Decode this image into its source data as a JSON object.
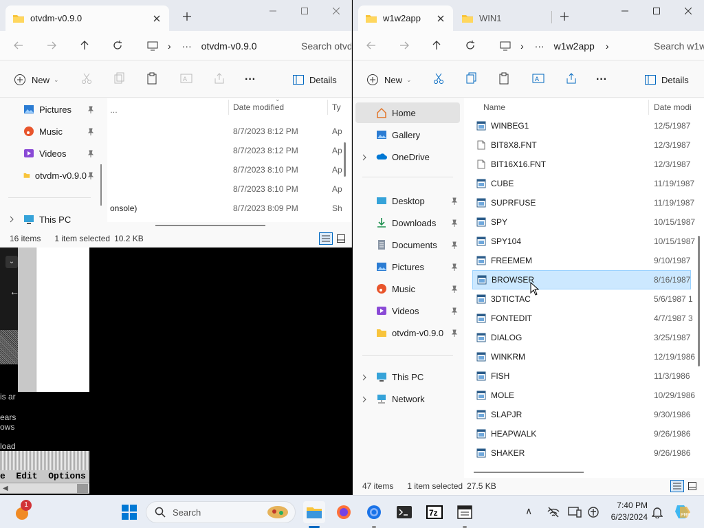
{
  "left_window": {
    "tab_title": "otvdm-v0.9.0",
    "address": "otvdm-v0.9.0",
    "search_placeholder": "Search otvd",
    "new_label": "New",
    "details_label": "Details",
    "sidebar": [
      {
        "label": "Pictures",
        "icon": "pictures-icon"
      },
      {
        "label": "Music",
        "icon": "music-icon"
      },
      {
        "label": "Videos",
        "icon": "videos-icon"
      },
      {
        "label": "otvdm-v0.9.0",
        "icon": "folder-icon"
      },
      {
        "label": "This PC",
        "icon": "this-pc-icon"
      }
    ],
    "columns": {
      "date": "Date modified",
      "type": "Ty"
    },
    "rows": [
      {
        "name": "",
        "date": "8/7/2023 8:12 PM",
        "type": "Ap"
      },
      {
        "name": "",
        "date": "8/7/2023 8:12 PM",
        "type": "Ap"
      },
      {
        "name": "",
        "date": "8/7/2023 8:10 PM",
        "type": "Ap"
      },
      {
        "name": "",
        "date": "8/7/2023 8:10 PM",
        "type": "Ap"
      },
      {
        "name": "onsole)",
        "date": "8/7/2023 8:09 PM",
        "type": "Sh"
      }
    ],
    "status": {
      "count": "16 items",
      "selected": "1 item selected",
      "size": "10.2 KB"
    }
  },
  "right_window": {
    "tabs": [
      {
        "label": "w1w2app"
      },
      {
        "label": "WIN1"
      }
    ],
    "address": "w1w2app",
    "search_placeholder": "Search w1w",
    "new_label": "New",
    "details_label": "Details",
    "sidebar": [
      {
        "label": "Home",
        "icon": "home-icon"
      },
      {
        "label": "Gallery",
        "icon": "gallery-icon"
      },
      {
        "label": "OneDrive",
        "icon": "onedrive-icon"
      },
      {
        "label": "Desktop",
        "icon": "desktop-icon"
      },
      {
        "label": "Downloads",
        "icon": "downloads-icon"
      },
      {
        "label": "Documents",
        "icon": "documents-icon"
      },
      {
        "label": "Pictures",
        "icon": "pictures-icon"
      },
      {
        "label": "Music",
        "icon": "music-icon"
      },
      {
        "label": "Videos",
        "icon": "videos-icon"
      },
      {
        "label": "otvdm-v0.9.0",
        "icon": "folder-icon"
      },
      {
        "label": "This PC",
        "icon": "this-pc-icon"
      },
      {
        "label": "Network",
        "icon": "network-icon"
      }
    ],
    "columns": {
      "name": "Name",
      "date": "Date modi"
    },
    "files": [
      {
        "name": "WINBEG1",
        "date": "12/5/1987",
        "kind": "app"
      },
      {
        "name": "BIT8X8.FNT",
        "date": "12/3/1987",
        "kind": "doc"
      },
      {
        "name": "BIT16X16.FNT",
        "date": "12/3/1987",
        "kind": "doc"
      },
      {
        "name": "CUBE",
        "date": "11/19/1987",
        "kind": "app"
      },
      {
        "name": "SUPRFUSE",
        "date": "11/19/1987",
        "kind": "app"
      },
      {
        "name": "SPY",
        "date": "10/15/1987",
        "kind": "app"
      },
      {
        "name": "SPY104",
        "date": "10/15/1987",
        "kind": "app"
      },
      {
        "name": "FREEMEM",
        "date": "9/10/1987",
        "kind": "app"
      },
      {
        "name": "BROWSER",
        "date": "8/16/1987",
        "kind": "app"
      },
      {
        "name": "3DTICTAC",
        "date": "5/6/1987 1",
        "kind": "app"
      },
      {
        "name": "FONTEDIT",
        "date": "4/7/1987 3",
        "kind": "app"
      },
      {
        "name": "DIALOG",
        "date": "3/25/1987",
        "kind": "app"
      },
      {
        "name": "WINKRM",
        "date": "12/19/1986",
        "kind": "app"
      },
      {
        "name": "FISH",
        "date": "11/3/1986",
        "kind": "app"
      },
      {
        "name": "MOLE",
        "date": "10/29/1986",
        "kind": "app"
      },
      {
        "name": "SLAPJR",
        "date": "9/30/1986",
        "kind": "app"
      },
      {
        "name": "HEAPWALK",
        "date": "9/26/1986",
        "kind": "app"
      },
      {
        "name": "SHAKER",
        "date": "9/26/1986",
        "kind": "app"
      }
    ],
    "selected_file": "BROWSER",
    "status": {
      "count": "47 items",
      "selected": "1 item selected",
      "size": "27.5 KB"
    }
  },
  "background_window": {
    "text_lines": [
      "is ar",
      "ears",
      "ows",
      "load"
    ],
    "menu_text": "e  Edit  Options"
  },
  "taskbar": {
    "search_placeholder": "Search",
    "time": "7:40 PM",
    "date": "6/23/2024",
    "badge_count": "1",
    "icons": [
      "file-explorer-icon",
      "firefox-icon",
      "chrome-icon",
      "terminal-icon",
      "7zip-icon",
      "app-icon"
    ]
  },
  "colors": {
    "accent": "#0067c0",
    "selection": "#cce8ff",
    "folder": "#f8c43c",
    "taskbar": "#e8edf5"
  }
}
